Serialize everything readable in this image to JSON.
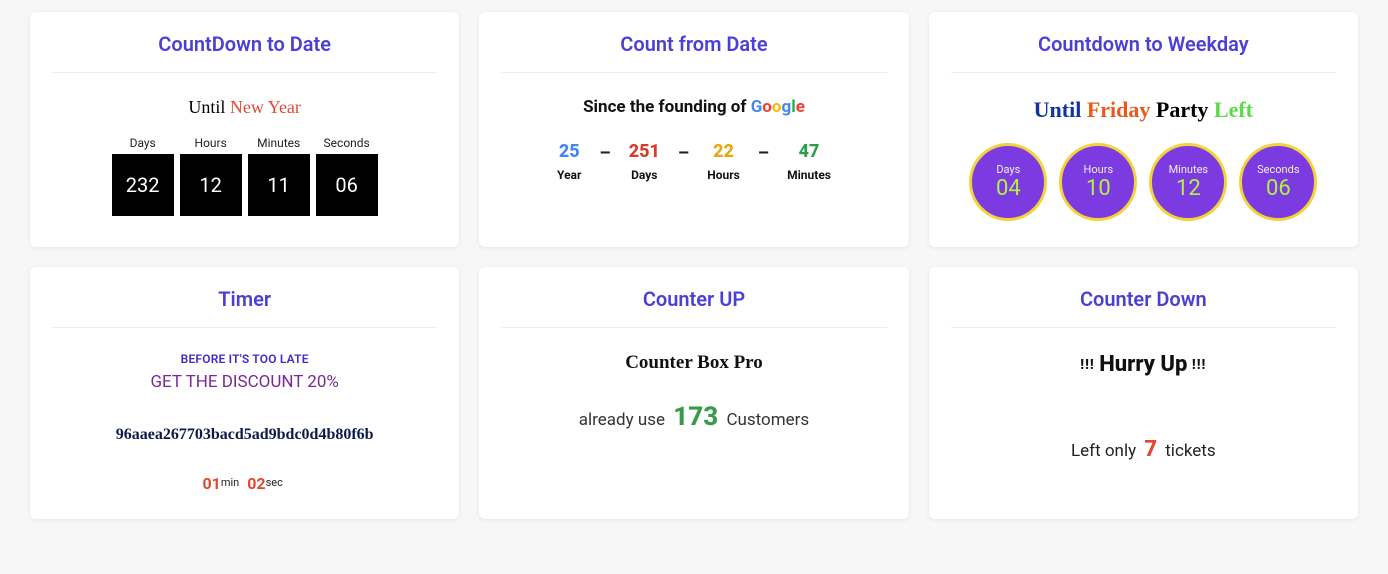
{
  "card1": {
    "title": "CountDown to Date",
    "heading_before": "Until ",
    "heading_highlight": "New Year",
    "units": {
      "days_label": "Days",
      "hours_label": "Hours",
      "minutes_label": "Minutes",
      "seconds_label": "Seconds",
      "days": "232",
      "hours": "12",
      "minutes": "11",
      "seconds": "06"
    }
  },
  "card2": {
    "title": "Count from Date",
    "heading_before": "Since the founding of ",
    "google": {
      "g1": "G",
      "o1": "o",
      "o2": "o",
      "g2": "g",
      "l": "l",
      "e": "e"
    },
    "sep": "–",
    "year": {
      "value": "25",
      "label": "Year"
    },
    "days": {
      "value": "251",
      "label": "Days"
    },
    "hours": {
      "value": "22",
      "label": "Hours"
    },
    "minutes": {
      "value": "47",
      "label": "Minutes"
    }
  },
  "card3": {
    "title": "Countdown to Weekday",
    "heading": {
      "w1": "Until",
      "w2": "Friday",
      "w3": "Party",
      "w4": "Left"
    },
    "circles": {
      "days": {
        "label": "Days",
        "value": "04"
      },
      "hours": {
        "label": "Hours",
        "value": "10"
      },
      "minutes": {
        "label": "Minutes",
        "value": "12"
      },
      "seconds": {
        "label": "Seconds",
        "value": "06"
      }
    }
  },
  "card4": {
    "title": "Timer",
    "preline": "BEFORE IT'S TOO LATE",
    "discount": "GET THE DISCOUNT 20%",
    "hash": "96aaea267703bacd5ad9bdc0d4b80f6b",
    "timer": {
      "min_val": "01",
      "min_lbl": "min",
      "sec_val": "02",
      "sec_lbl": "sec"
    }
  },
  "card5": {
    "title": "Counter UP",
    "heading": "Counter Box Pro",
    "before": "already use ",
    "number": "173",
    "after": " Customers"
  },
  "card6": {
    "title": "Counter Down",
    "excl_left": "!!! ",
    "heading": "Hurry Up",
    "excl_right": " !!!",
    "before": "Left only ",
    "number": "7",
    "after": " tickets"
  }
}
